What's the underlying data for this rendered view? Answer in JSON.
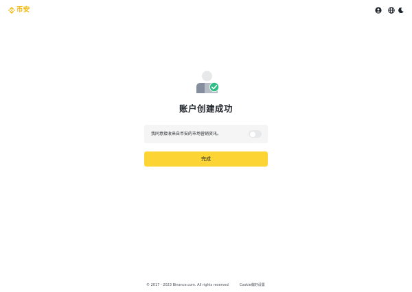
{
  "header": {
    "logo_text": "币安",
    "brand_color": "#F0B90B",
    "icons": [
      "account-icon",
      "language-globe-icon",
      "dark-mode-moon-icon"
    ]
  },
  "main": {
    "illustration": "account-created-success-illustration",
    "title": "账户创建成功",
    "consent": {
      "label": "我同意接收来自币安的市场营销资讯。",
      "toggle_on": false
    },
    "done_button_label": "完成",
    "button_color": "#FCD535"
  },
  "footer": {
    "copyright": "© 2017 - 2023 Binance.com. All rights reserved",
    "cookie_link": "Cookie偏好设置"
  }
}
